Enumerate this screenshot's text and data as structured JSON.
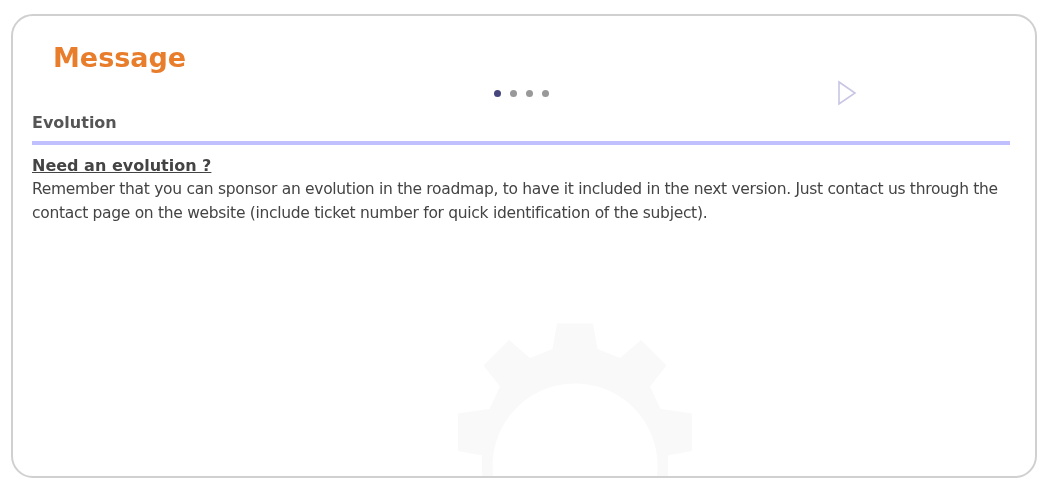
{
  "panel": {
    "title": "Message"
  },
  "carousel": {
    "pages": [
      {
        "selected": true
      },
      {
        "selected": false
      },
      {
        "selected": false
      },
      {
        "selected": false
      }
    ]
  },
  "section": {
    "heading": "Evolution",
    "subheading": "Need an evolution ?",
    "body": "Remember that you can sponsor an evolution in the roadmap, to have it included in the next version. Just contact us through the contact page on the website (include ticket number for quick identification of the subject)."
  }
}
